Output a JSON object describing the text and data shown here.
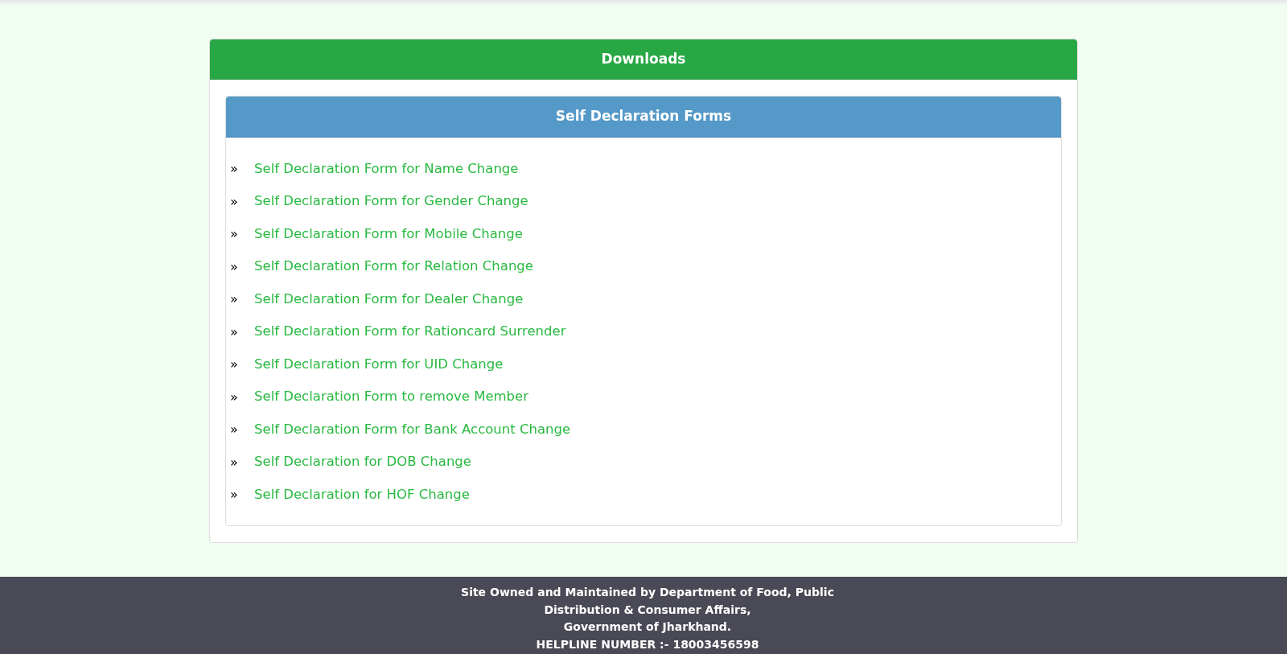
{
  "card": {
    "title": "Downloads"
  },
  "panel": {
    "title": "Self Declaration Forms",
    "links": [
      {
        "bullet": "»",
        "label": "Self Declaration Form for Name Change"
      },
      {
        "bullet": "»",
        "label": "Self Declaration Form for Gender Change"
      },
      {
        "bullet": "»",
        "label": "Self Declaration Form for Mobile Change"
      },
      {
        "bullet": "»",
        "label": "Self Declaration Form for Relation Change"
      },
      {
        "bullet": "»",
        "label": "Self Declaration Form for Dealer Change"
      },
      {
        "bullet": "»",
        "label": "Self Declaration Form for Rationcard Surrender"
      },
      {
        "bullet": "»",
        "label": "Self Declaration Form for UID Change"
      },
      {
        "bullet": "»",
        "label": "Self Declaration Form to remove Member"
      },
      {
        "bullet": "»",
        "label": "Self Declaration Form for Bank Account Change"
      },
      {
        "bullet": "»",
        "label": "Self Declaration for DOB Change"
      },
      {
        "bullet": "»",
        "label": "Self Declaration for HOF Change"
      }
    ]
  },
  "footer": {
    "lines": [
      "Site Owned and Maintained by Department of Food, Public Distribution & Consumer Affairs,",
      "Government of Jharkhand.",
      "HELPLINE NUMBER :- 18003456598"
    ]
  }
}
